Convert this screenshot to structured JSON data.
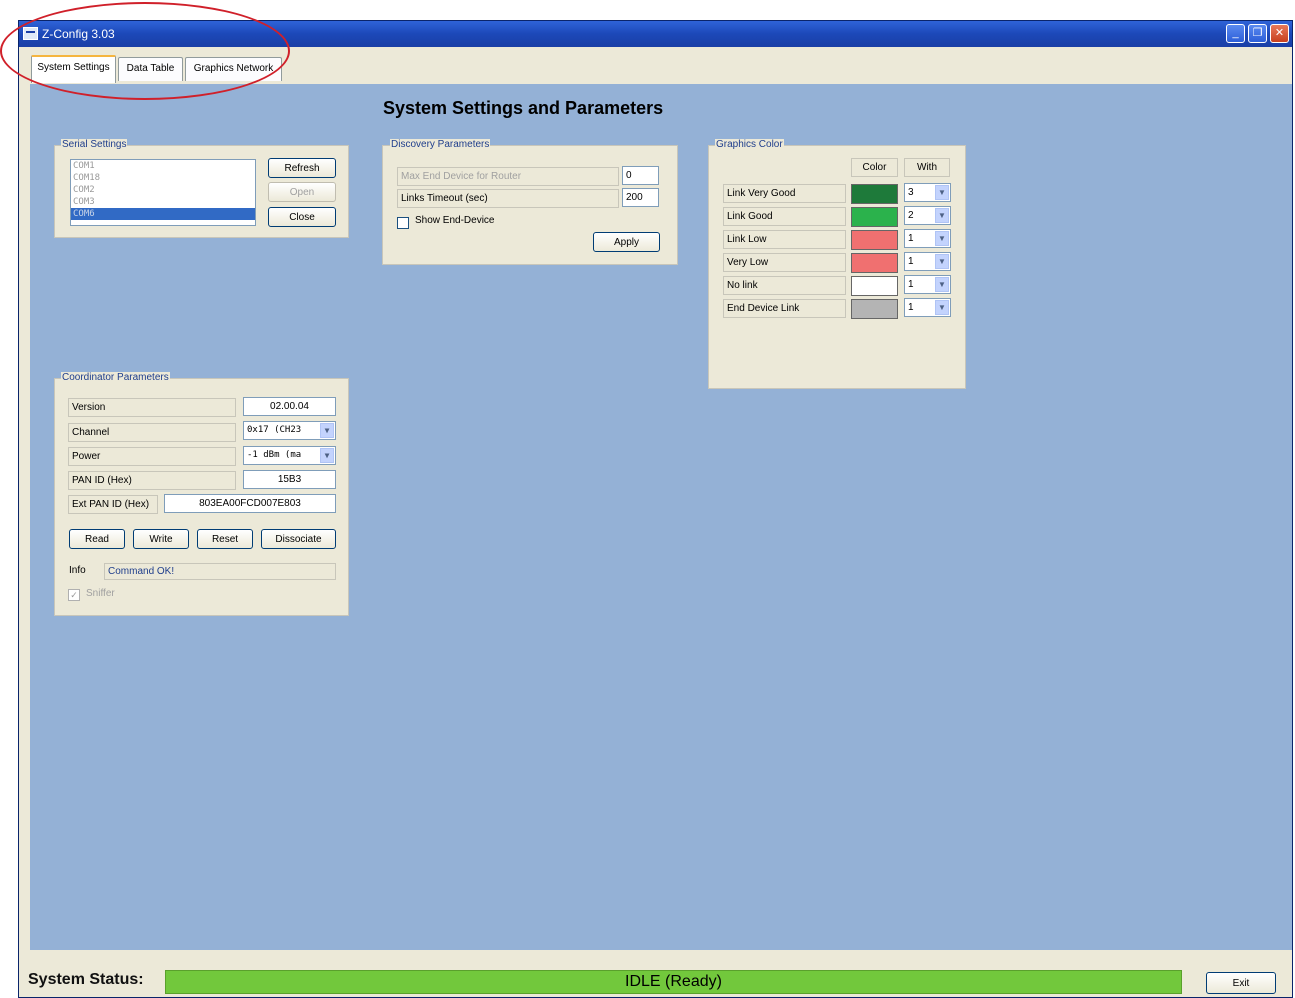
{
  "window": {
    "title": "Z-Config 3.03"
  },
  "tabs": [
    {
      "label": "System Settings"
    },
    {
      "label": "Data Table"
    },
    {
      "label": "Graphics Network"
    }
  ],
  "page_title": "System Settings and Parameters",
  "serial": {
    "legend": "Serial Settings",
    "ports": [
      "COM1",
      "COM18",
      "COM2",
      "COM3",
      "COM6"
    ],
    "refresh": "Refresh",
    "open": "Open",
    "close": "Close"
  },
  "discovery": {
    "legend": "Discovery Parameters",
    "max_label": "Max End Device for Router",
    "max_value": "0",
    "timeout_label": "Links Timeout (sec)",
    "timeout_value": "200",
    "show_label": "Show End-Device",
    "apply": "Apply"
  },
  "graphics": {
    "legend": "Graphics Color",
    "col_color": "Color",
    "col_width": "With",
    "rows": [
      {
        "label": "Link Very Good",
        "color": "#1e7a3a",
        "width": "3"
      },
      {
        "label": "Link Good",
        "color": "#2bb24c",
        "width": "2"
      },
      {
        "label": "Link Low",
        "color": "#f07070",
        "width": "1"
      },
      {
        "label": "Very Low",
        "color": "#f07070",
        "width": "1"
      },
      {
        "label": "No link",
        "color": "#ffffff",
        "width": "1"
      },
      {
        "label": "End Device Link",
        "color": "#b4b4b4",
        "width": "1"
      }
    ]
  },
  "coordinator": {
    "legend": "Coordinator Parameters",
    "version_label": "Version",
    "version_value": "02.00.04",
    "channel_label": "Channel",
    "channel_value": "0x17 (CH23",
    "power_label": "Power",
    "power_value": "-1 dBm (ma",
    "pan_label": "PAN ID (Hex)",
    "pan_value": "15B3",
    "ext_pan_label": "Ext PAN ID (Hex)",
    "ext_pan_value": "803EA00FCD007E803",
    "read": "Read",
    "write": "Write",
    "reset": "Reset",
    "dissociate": "Dissociate",
    "info_label": "Info",
    "info_value": "Command OK!",
    "sniffer_label": "Sniffer"
  },
  "status": {
    "label": "System Status:",
    "value": "IDLE (Ready)",
    "exit": "Exit"
  }
}
